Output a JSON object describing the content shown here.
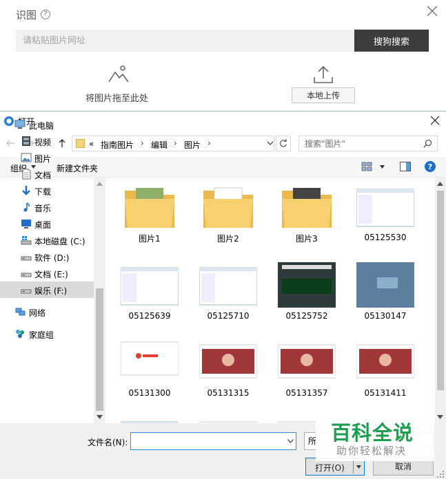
{
  "search_panel": {
    "title": "识图",
    "url_placeholder": "请粘贴图片网址",
    "search_button": "搜狗搜索",
    "drag_label": "将图片拖至此处",
    "upload_button": "本地上传"
  },
  "dialog": {
    "title": "打开",
    "address": {
      "prefix": "«",
      "crumbs": [
        "指南图片",
        "编辑",
        "图片"
      ]
    },
    "search_placeholder": "搜索\"图片\"",
    "toolbar": {
      "organize": "组织",
      "new_folder": "新建文件夹"
    },
    "sidebar": [
      {
        "label": "此电脑",
        "icon": "computer-icon"
      },
      {
        "label": "视频",
        "icon": "video-icon"
      },
      {
        "label": "图片",
        "icon": "pictures-icon"
      },
      {
        "label": "文档",
        "icon": "documents-icon"
      },
      {
        "label": "下载",
        "icon": "download-icon"
      },
      {
        "label": "音乐",
        "icon": "music-icon"
      },
      {
        "label": "桌面",
        "icon": "desktop-icon"
      },
      {
        "label": "本地磁盘 (C:)",
        "icon": "windows-drive-icon"
      },
      {
        "label": "软件 (D:)",
        "icon": "drive-icon"
      },
      {
        "label": "文档 (E:)",
        "icon": "drive-icon"
      },
      {
        "label": "娱乐 (F:)",
        "icon": "drive-icon",
        "selected": true
      },
      {
        "label": "网络",
        "icon": "network-icon"
      },
      {
        "label": "家庭组",
        "icon": "homegroup-icon"
      }
    ],
    "files": [
      {
        "name": "图片1",
        "kind": "folder"
      },
      {
        "name": "图片2",
        "kind": "folder"
      },
      {
        "name": "图片3",
        "kind": "folder"
      },
      {
        "name": "05125530",
        "kind": "image"
      },
      {
        "name": "05125639",
        "kind": "image"
      },
      {
        "name": "05125710",
        "kind": "image"
      },
      {
        "name": "05125752",
        "kind": "image"
      },
      {
        "name": "05130147",
        "kind": "image"
      },
      {
        "name": "05131300",
        "kind": "image"
      },
      {
        "name": "05131315",
        "kind": "image"
      },
      {
        "name": "05131357",
        "kind": "image"
      },
      {
        "name": "05131411",
        "kind": "image"
      },
      {
        "name": "",
        "kind": "image"
      },
      {
        "name": "",
        "kind": "image"
      },
      {
        "name": "",
        "kind": "image"
      },
      {
        "name": "",
        "kind": "image"
      }
    ],
    "bottom": {
      "filename_label": "文件名(N):",
      "filename_value": "",
      "filetype_visible": "所",
      "open_button": "打开(O)",
      "cancel_button": "取消"
    }
  },
  "watermark": {
    "main": "百科全说",
    "sub": "助你轻松解决"
  }
}
